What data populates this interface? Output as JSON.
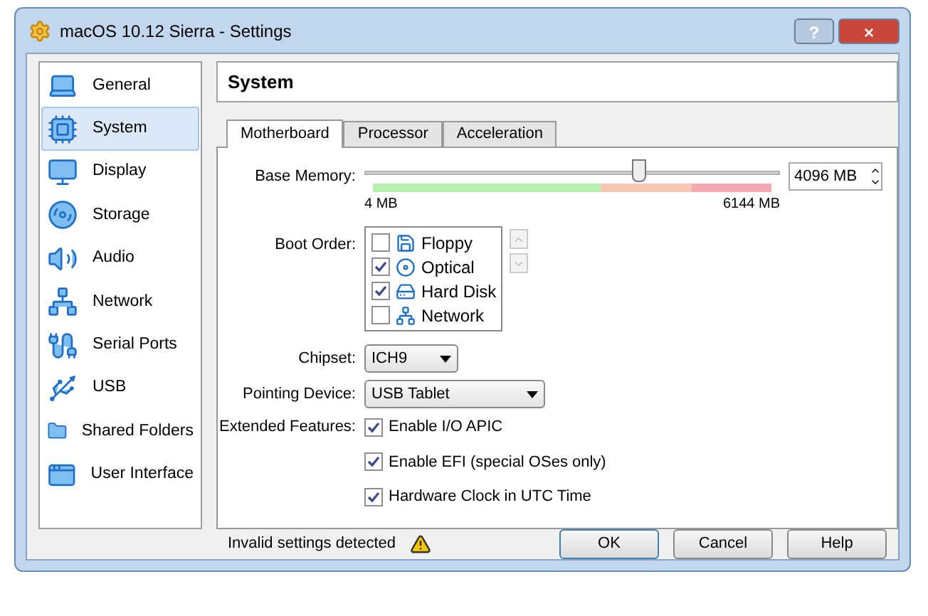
{
  "window": {
    "title": "macOS 10.12 Sierra - Settings",
    "buttons": [
      "?",
      "×"
    ]
  },
  "sidebar": {
    "items": [
      {
        "label": "General",
        "kind": "general",
        "selected": false
      },
      {
        "label": "System",
        "kind": "system",
        "selected": true
      },
      {
        "label": "Display",
        "kind": "display",
        "selected": false
      },
      {
        "label": "Storage",
        "kind": "storage",
        "selected": false
      },
      {
        "label": "Audio",
        "kind": "audio",
        "selected": false
      },
      {
        "label": "Network",
        "kind": "network",
        "selected": false
      },
      {
        "label": "Serial Ports",
        "kind": "serial",
        "selected": false
      },
      {
        "label": "USB",
        "kind": "usb",
        "selected": false
      },
      {
        "label": "Shared Folders",
        "kind": "folders",
        "selected": false
      },
      {
        "label": "User Interface",
        "kind": "ui",
        "selected": false
      }
    ]
  },
  "page_title": "System",
  "tabs": [
    {
      "label": "Motherboard",
      "selected": true
    },
    {
      "label": "Processor",
      "selected": false
    },
    {
      "label": "Acceleration",
      "selected": false
    }
  ],
  "base_memory": {
    "label": "Base Memory:",
    "level": 0.66,
    "min_label": "4 MB",
    "max_label": "6144 MB",
    "value": "4096 MB"
  },
  "boot_order": {
    "label": "Boot Order:",
    "items": [
      {
        "label": "Floppy",
        "kind": "floppy",
        "checked": false
      },
      {
        "label": "Optical",
        "kind": "optical",
        "checked": true
      },
      {
        "label": "Hard Disk",
        "kind": "disk",
        "checked": true
      },
      {
        "label": "Network",
        "kind": "network",
        "checked": false
      }
    ]
  },
  "chipset": {
    "label": "Chipset:",
    "value": "ICH9"
  },
  "pointing_device": {
    "label": "Pointing Device:",
    "value": "USB Tablet"
  },
  "extended_features": {
    "label": "Extended Features:",
    "items": [
      {
        "label": "Enable I/O APIC",
        "checked": true
      },
      {
        "label": "Enable EFI (special OSes only)",
        "checked": true
      },
      {
        "label": "Hardware Clock in UTC Time",
        "checked": true
      }
    ]
  },
  "status": {
    "text": "Invalid settings detected"
  },
  "buttons": [
    "OK",
    "Cancel",
    "Help"
  ]
}
